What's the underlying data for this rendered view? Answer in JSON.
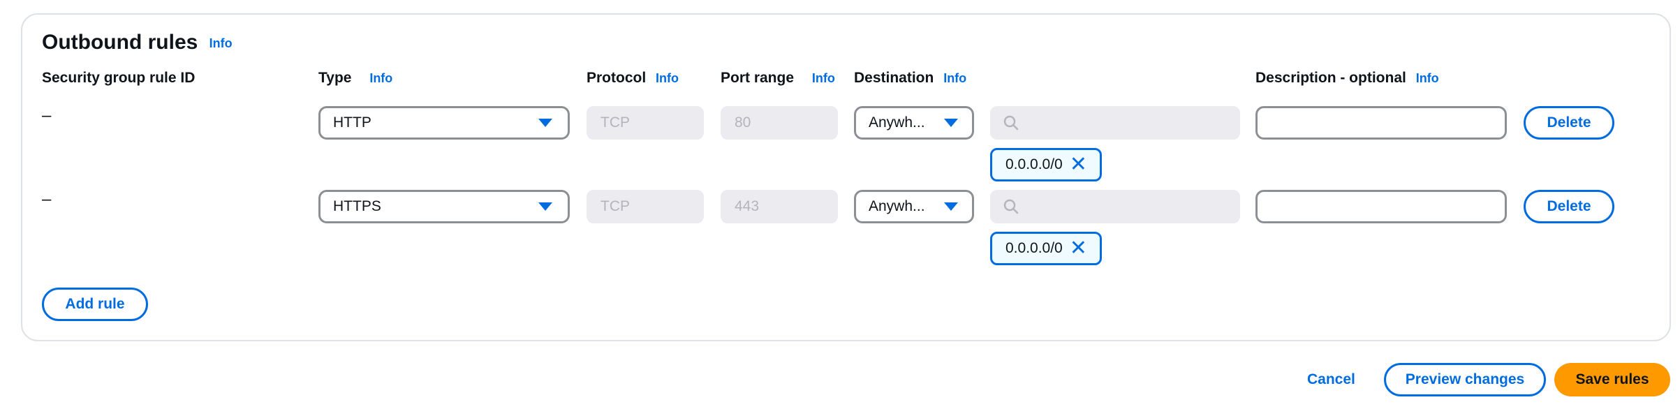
{
  "section": {
    "title": "Outbound rules",
    "info": "Info"
  },
  "columns": {
    "rule_id": "Security group rule ID",
    "type": "Type",
    "protocol": "Protocol",
    "port_range": "Port range",
    "destination": "Destination",
    "description": "Description - optional",
    "info": "Info"
  },
  "rules": [
    {
      "rule_id": "–",
      "type": "HTTP",
      "protocol": "TCP",
      "port_range": "80",
      "destination": "Anywh...",
      "search_value": "",
      "cidr": "0.0.0.0/0",
      "description": "",
      "delete_label": "Delete"
    },
    {
      "rule_id": "–",
      "type": "HTTPS",
      "protocol": "TCP",
      "port_range": "443",
      "destination": "Anywh...",
      "search_value": "",
      "cidr": "0.0.0.0/0",
      "description": "",
      "delete_label": "Delete"
    }
  ],
  "add_rule_label": "Add rule",
  "footer": {
    "cancel_label": "Cancel",
    "preview_label": "Preview changes",
    "save_label": "Save rules"
  },
  "icons": {
    "search": "search-icon",
    "dropdown": "caret-down-icon",
    "remove_token": "close-icon"
  },
  "colors": {
    "accent": "#006ce0",
    "primary_button": "#ff9900",
    "disabled_bg": "#ebebf0",
    "border": "#8c8f94"
  }
}
